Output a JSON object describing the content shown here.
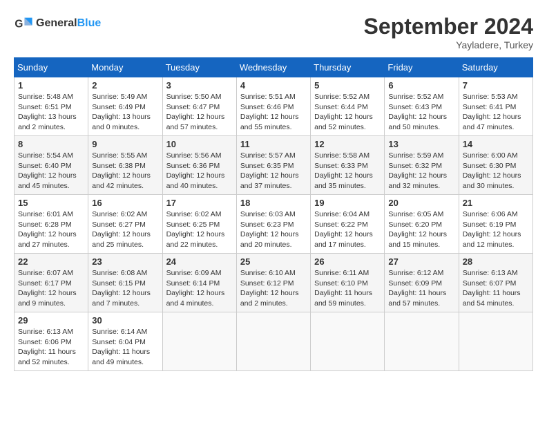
{
  "header": {
    "logo_general": "General",
    "logo_blue": "Blue",
    "month": "September 2024",
    "location": "Yayladere, Turkey"
  },
  "days_of_week": [
    "Sunday",
    "Monday",
    "Tuesday",
    "Wednesday",
    "Thursday",
    "Friday",
    "Saturday"
  ],
  "weeks": [
    [
      {
        "day": "1",
        "info": "Sunrise: 5:48 AM\nSunset: 6:51 PM\nDaylight: 13 hours and 2 minutes."
      },
      {
        "day": "2",
        "info": "Sunrise: 5:49 AM\nSunset: 6:49 PM\nDaylight: 13 hours and 0 minutes."
      },
      {
        "day": "3",
        "info": "Sunrise: 5:50 AM\nSunset: 6:47 PM\nDaylight: 12 hours and 57 minutes."
      },
      {
        "day": "4",
        "info": "Sunrise: 5:51 AM\nSunset: 6:46 PM\nDaylight: 12 hours and 55 minutes."
      },
      {
        "day": "5",
        "info": "Sunrise: 5:52 AM\nSunset: 6:44 PM\nDaylight: 12 hours and 52 minutes."
      },
      {
        "day": "6",
        "info": "Sunrise: 5:52 AM\nSunset: 6:43 PM\nDaylight: 12 hours and 50 minutes."
      },
      {
        "day": "7",
        "info": "Sunrise: 5:53 AM\nSunset: 6:41 PM\nDaylight: 12 hours and 47 minutes."
      }
    ],
    [
      {
        "day": "8",
        "info": "Sunrise: 5:54 AM\nSunset: 6:40 PM\nDaylight: 12 hours and 45 minutes."
      },
      {
        "day": "9",
        "info": "Sunrise: 5:55 AM\nSunset: 6:38 PM\nDaylight: 12 hours and 42 minutes."
      },
      {
        "day": "10",
        "info": "Sunrise: 5:56 AM\nSunset: 6:36 PM\nDaylight: 12 hours and 40 minutes."
      },
      {
        "day": "11",
        "info": "Sunrise: 5:57 AM\nSunset: 6:35 PM\nDaylight: 12 hours and 37 minutes."
      },
      {
        "day": "12",
        "info": "Sunrise: 5:58 AM\nSunset: 6:33 PM\nDaylight: 12 hours and 35 minutes."
      },
      {
        "day": "13",
        "info": "Sunrise: 5:59 AM\nSunset: 6:32 PM\nDaylight: 12 hours and 32 minutes."
      },
      {
        "day": "14",
        "info": "Sunrise: 6:00 AM\nSunset: 6:30 PM\nDaylight: 12 hours and 30 minutes."
      }
    ],
    [
      {
        "day": "15",
        "info": "Sunrise: 6:01 AM\nSunset: 6:28 PM\nDaylight: 12 hours and 27 minutes."
      },
      {
        "day": "16",
        "info": "Sunrise: 6:02 AM\nSunset: 6:27 PM\nDaylight: 12 hours and 25 minutes."
      },
      {
        "day": "17",
        "info": "Sunrise: 6:02 AM\nSunset: 6:25 PM\nDaylight: 12 hours and 22 minutes."
      },
      {
        "day": "18",
        "info": "Sunrise: 6:03 AM\nSunset: 6:23 PM\nDaylight: 12 hours and 20 minutes."
      },
      {
        "day": "19",
        "info": "Sunrise: 6:04 AM\nSunset: 6:22 PM\nDaylight: 12 hours and 17 minutes."
      },
      {
        "day": "20",
        "info": "Sunrise: 6:05 AM\nSunset: 6:20 PM\nDaylight: 12 hours and 15 minutes."
      },
      {
        "day": "21",
        "info": "Sunrise: 6:06 AM\nSunset: 6:19 PM\nDaylight: 12 hours and 12 minutes."
      }
    ],
    [
      {
        "day": "22",
        "info": "Sunrise: 6:07 AM\nSunset: 6:17 PM\nDaylight: 12 hours and 9 minutes."
      },
      {
        "day": "23",
        "info": "Sunrise: 6:08 AM\nSunset: 6:15 PM\nDaylight: 12 hours and 7 minutes."
      },
      {
        "day": "24",
        "info": "Sunrise: 6:09 AM\nSunset: 6:14 PM\nDaylight: 12 hours and 4 minutes."
      },
      {
        "day": "25",
        "info": "Sunrise: 6:10 AM\nSunset: 6:12 PM\nDaylight: 12 hours and 2 minutes."
      },
      {
        "day": "26",
        "info": "Sunrise: 6:11 AM\nSunset: 6:10 PM\nDaylight: 11 hours and 59 minutes."
      },
      {
        "day": "27",
        "info": "Sunrise: 6:12 AM\nSunset: 6:09 PM\nDaylight: 11 hours and 57 minutes."
      },
      {
        "day": "28",
        "info": "Sunrise: 6:13 AM\nSunset: 6:07 PM\nDaylight: 11 hours and 54 minutes."
      }
    ],
    [
      {
        "day": "29",
        "info": "Sunrise: 6:13 AM\nSunset: 6:06 PM\nDaylight: 11 hours and 52 minutes."
      },
      {
        "day": "30",
        "info": "Sunrise: 6:14 AM\nSunset: 6:04 PM\nDaylight: 11 hours and 49 minutes."
      },
      {
        "day": "",
        "info": ""
      },
      {
        "day": "",
        "info": ""
      },
      {
        "day": "",
        "info": ""
      },
      {
        "day": "",
        "info": ""
      },
      {
        "day": "",
        "info": ""
      }
    ]
  ]
}
